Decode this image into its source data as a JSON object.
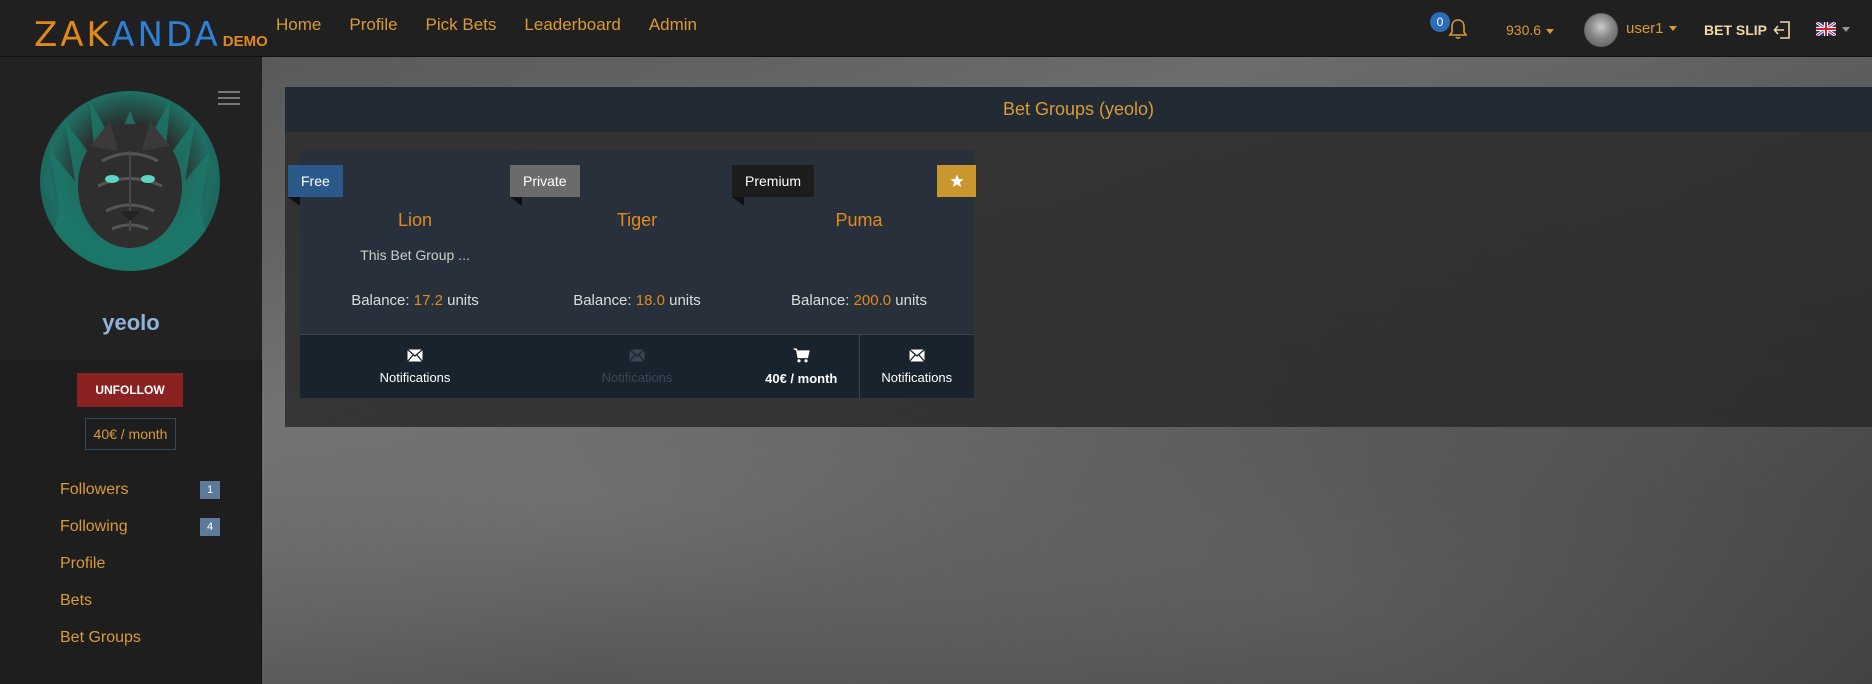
{
  "brand": {
    "name_part1": "ZAK",
    "name_part2": "ANDA",
    "demo": "DEMO",
    "color_orange": "#e08a1e",
    "color_blue": "#2f7fd6"
  },
  "nav": {
    "items": [
      {
        "label": "Home"
      },
      {
        "label": "Profile"
      },
      {
        "label": "Pick Bets"
      },
      {
        "label": "Leaderboard"
      },
      {
        "label": "Admin"
      }
    ]
  },
  "header": {
    "notification_count": "0",
    "balance": "930.6",
    "username": "user1",
    "betslip_label": "BET SLIP",
    "language_flag": "uk-flag-icon"
  },
  "sidebar": {
    "profile_name": "yeolo",
    "unfollow_label": "UNFOLLOW",
    "price": "40€ / month",
    "menu": [
      {
        "label": "Followers",
        "count": "1"
      },
      {
        "label": "Following",
        "count": "4"
      },
      {
        "label": "Profile"
      },
      {
        "label": "Bets"
      },
      {
        "label": "Bet Groups"
      }
    ]
  },
  "main": {
    "panel_title": "Bet Groups (yeolo)",
    "cards": [
      {
        "label": "Free",
        "label_color": "#2a5a8a",
        "title": "Lion",
        "description": "This Bet Group ...",
        "balance_prefix": "Balance:",
        "balance_value": "17.2",
        "balance_suffix": "units",
        "actions": [
          {
            "label": "Notifications",
            "icon": "envelope-icon"
          }
        ]
      },
      {
        "label": "Private",
        "label_color": "#6b6b6b",
        "title": "Tiger",
        "description": "",
        "balance_prefix": "Balance:",
        "balance_value": "18.0",
        "balance_suffix": "units",
        "actions": [
          {
            "label": "Notifications",
            "icon": "envelope-icon",
            "disabled": true
          }
        ]
      },
      {
        "label": "Premium",
        "label_color": "#1c1c1c",
        "title": "Puma",
        "description": "",
        "balance_prefix": "Balance:",
        "balance_value": "200.0",
        "balance_suffix": "units",
        "starred": true,
        "actions": [
          {
            "label": "40€ / month",
            "icon": "cart-icon"
          },
          {
            "label": "Notifications",
            "icon": "envelope-icon"
          }
        ]
      }
    ]
  }
}
